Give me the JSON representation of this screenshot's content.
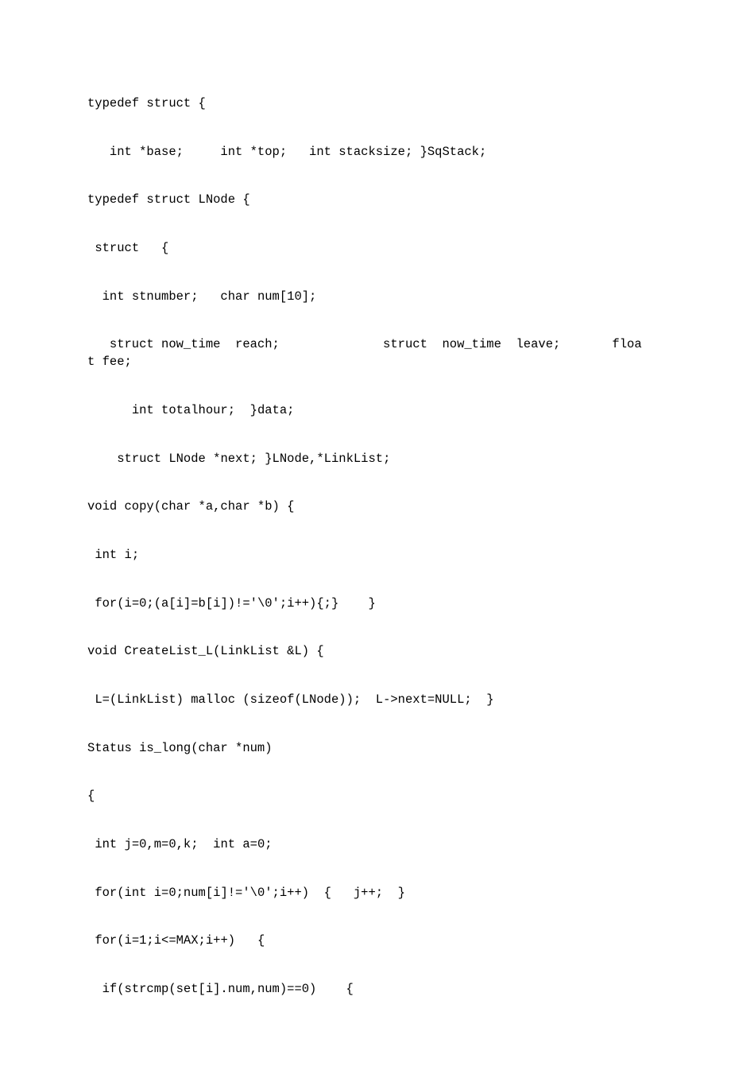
{
  "code": {
    "lines": [
      "typedef struct {",
      "   int *base;     int *top;   int stacksize; }SqStack;",
      "typedef struct LNode {",
      " struct   {",
      "  int stnumber;   char num[10];",
      "   struct now_time  reach;              struct  now_time  leave;       float fee;",
      "      int totalhour;  }data;",
      "    struct LNode *next; }LNode,*LinkList;",
      "void copy(char *a,char *b) {",
      " int i;",
      " for(i=0;(a[i]=b[i])!='\\0';i++){;}    }",
      "void CreateList_L(LinkList &L) {",
      " L=(LinkList) malloc (sizeof(LNode));  L->next=NULL;  }",
      "Status is_long(char *num)",
      "{",
      " int j=0,m=0,k;  int a=0;",
      " for(int i=0;num[i]!='\\0';i++)  {   j++;  }",
      " for(i=1;i<=MAX;i++)   {",
      "  if(strcmp(set[i].num,num)==0)    {"
    ]
  }
}
